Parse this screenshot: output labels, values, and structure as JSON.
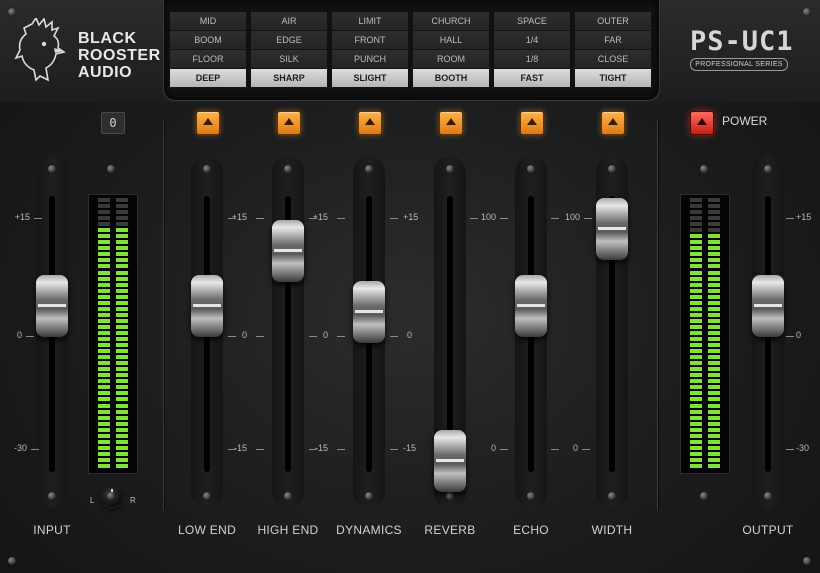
{
  "brand": {
    "line1": "BLACK",
    "line2": "ROOSTER",
    "line3": "AUDIO"
  },
  "product": {
    "name": "PS-UC1",
    "series": "PROFESSIONAL SERIES"
  },
  "mode_columns": [
    {
      "name": "low-end",
      "options": [
        "MID",
        "BOOM",
        "FLOOR",
        "DEEP"
      ],
      "selected": "DEEP"
    },
    {
      "name": "high-end",
      "options": [
        "AIR",
        "EDGE",
        "SILK",
        "SHARP"
      ],
      "selected": "SHARP"
    },
    {
      "name": "dynamics",
      "options": [
        "LIMIT",
        "FRONT",
        "PUNCH",
        "SLIGHT"
      ],
      "selected": "SLIGHT"
    },
    {
      "name": "reverb",
      "options": [
        "CHURCH",
        "HALL",
        "ROOM",
        "BOOTH"
      ],
      "selected": "BOOTH"
    },
    {
      "name": "echo",
      "options": [
        "SPACE",
        "1/4",
        "1/8",
        "FAST"
      ],
      "selected": "FAST"
    },
    {
      "name": "width",
      "options": [
        "OUTER",
        "FAR",
        "CLOSE",
        "TIGHT"
      ],
      "selected": "TIGHT"
    }
  ],
  "zero_button": "0",
  "power_label": "POWER",
  "pan": {
    "left": "L",
    "right": "R"
  },
  "scales": {
    "db": [
      "+15",
      "0",
      "-15"
    ],
    "io": [
      "+15",
      "0",
      "-30"
    ],
    "percent": [
      "100",
      "0"
    ]
  },
  "channels": [
    {
      "id": "input",
      "label": "INPUT",
      "value": 0.6
    },
    {
      "id": "low-end",
      "label": "LOW END",
      "value": 0.6
    },
    {
      "id": "high-end",
      "label": "HIGH END",
      "value": 0.8
    },
    {
      "id": "dynamics",
      "label": "DYNAMICS",
      "value": 0.58
    },
    {
      "id": "reverb",
      "label": "REVERB",
      "value": 0.04
    },
    {
      "id": "echo",
      "label": "ECHO",
      "value": 0.6
    },
    {
      "id": "width",
      "label": "WIDTH",
      "value": 0.88
    },
    {
      "id": "output",
      "label": "OUTPUT",
      "value": 0.6
    }
  ],
  "meters": {
    "input_level": 0.88,
    "output_level": 0.87
  },
  "colors": {
    "accent_orange": "#f29a2e",
    "power_red": "#e2342a",
    "meter_green": "#7fe23a"
  }
}
